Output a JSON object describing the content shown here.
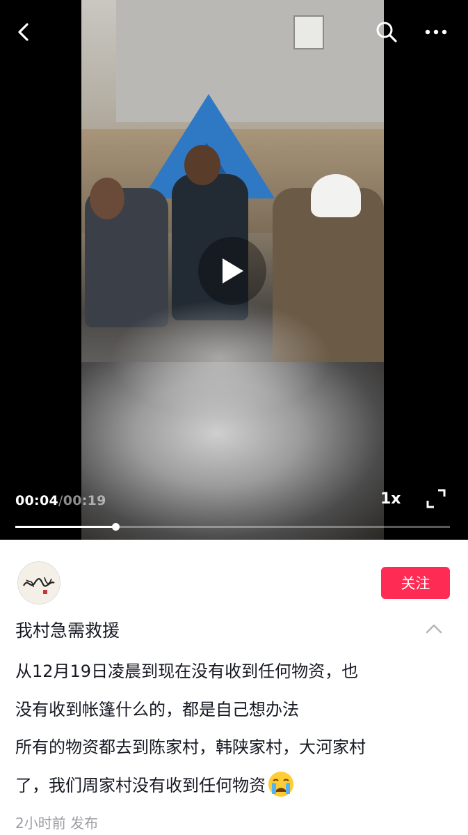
{
  "video": {
    "current_time": "00:04",
    "separator": "/",
    "duration": "00:19",
    "progress_fraction": 0.2296,
    "speed_label": "1x"
  },
  "topbar": {
    "back_icon": "chevron-left-icon",
    "search_icon": "search-icon",
    "more_icon": "more-dots-icon"
  },
  "author": {
    "follow_label": "关注",
    "accent_color": "#fe2c55"
  },
  "post": {
    "title": "我村急需救援",
    "lines": [
      "从12月19日凌晨到现在没有收到任何物资，也",
      "没有收到帐篷什么的，都是自己想办法",
      "所有的物资都去到陈家村，韩陕家村，大河家村",
      "了，我们周家村没有收到任何物资"
    ],
    "emoji": "crying-face-emoji",
    "meta": "2小时前 发布"
  }
}
